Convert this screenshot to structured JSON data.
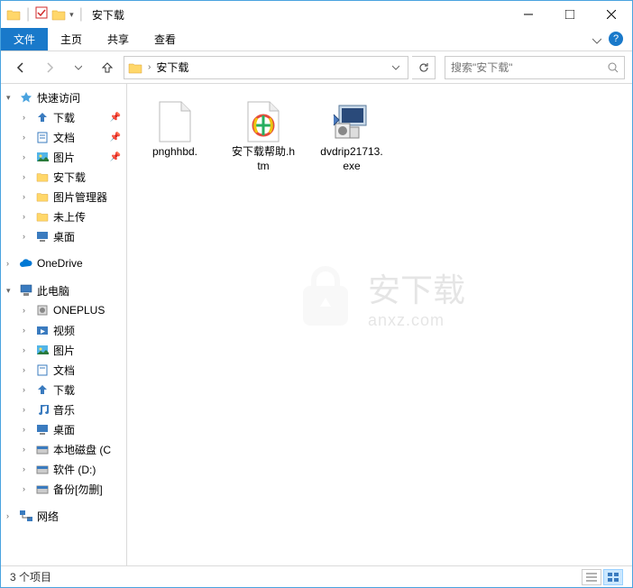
{
  "window": {
    "title": "安下载"
  },
  "qat": {
    "dropdown": "▾"
  },
  "tabs": {
    "file": "文件",
    "home": "主页",
    "share": "共享",
    "view": "查看"
  },
  "nav": {
    "back": "←",
    "forward": "→",
    "up": "↑"
  },
  "address": {
    "folder": "安下载",
    "sep": "›"
  },
  "search": {
    "placeholder": "搜索\"安下载\""
  },
  "sidebar": {
    "quick": "快速访问",
    "items": [
      {
        "label": "下载",
        "pinned": true
      },
      {
        "label": "文档",
        "pinned": true
      },
      {
        "label": "图片",
        "pinned": true
      },
      {
        "label": "安下载",
        "pinned": false
      },
      {
        "label": "图片管理器",
        "pinned": false
      },
      {
        "label": "未上传",
        "pinned": false
      },
      {
        "label": "桌面",
        "pinned": false
      }
    ],
    "onedrive": "OneDrive",
    "thispc": "此电脑",
    "pcitems": [
      {
        "label": "ONEPLUS"
      },
      {
        "label": "视频"
      },
      {
        "label": "图片"
      },
      {
        "label": "文档"
      },
      {
        "label": "下载"
      },
      {
        "label": "音乐"
      },
      {
        "label": "桌面"
      },
      {
        "label": "本地磁盘 (C"
      },
      {
        "label": "软件 (D:)"
      },
      {
        "label": "备份[勿删]"
      }
    ],
    "network": "网络"
  },
  "files": [
    {
      "name": "pnghhbd.",
      "type": "blank"
    },
    {
      "name": "安下载帮助.htm",
      "type": "htm"
    },
    {
      "name": "dvdrip21713.exe",
      "type": "exe"
    }
  ],
  "status": {
    "count": "3 个项目"
  },
  "watermark": {
    "main": "安下载",
    "sub": "anxz.com"
  }
}
